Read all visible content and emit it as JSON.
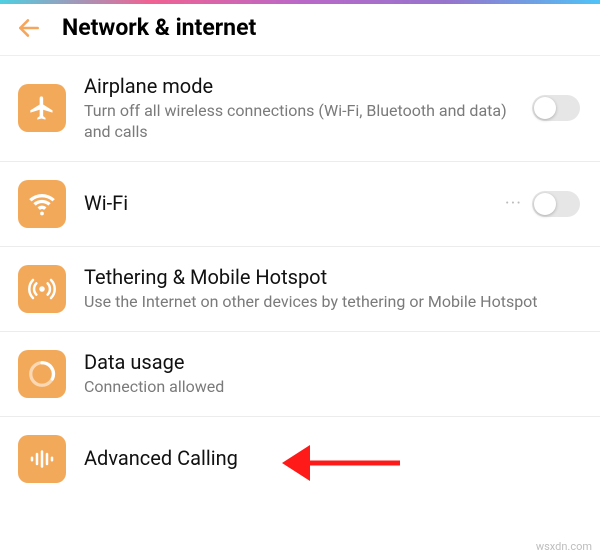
{
  "header": {
    "title": "Network & internet"
  },
  "rows": {
    "airplane": {
      "title": "Airplane mode",
      "sub": "Turn off all wireless connections (Wi-Fi, Bluetooth and data) and calls"
    },
    "wifi": {
      "title": "Wi-Fi",
      "more": "···"
    },
    "tether": {
      "title": "Tethering & Mobile Hotspot",
      "sub": "Use the Internet on other devices by tethering or Mobile Hotspot"
    },
    "data": {
      "title": "Data usage",
      "sub": "Connection allowed"
    },
    "advcall": {
      "title": "Advanced Calling"
    }
  },
  "icons": {
    "back": "back-arrow-icon",
    "airplane": "airplane-icon",
    "wifi": "wifi-icon",
    "hotspot": "hotspot-icon",
    "data": "data-usage-icon",
    "calling": "calling-bars-icon"
  },
  "colors": {
    "accent": "#f3a95a",
    "subtext": "#7a7a7a",
    "annotation": "#ff1a1a"
  },
  "watermark": "wsxdn.com"
}
